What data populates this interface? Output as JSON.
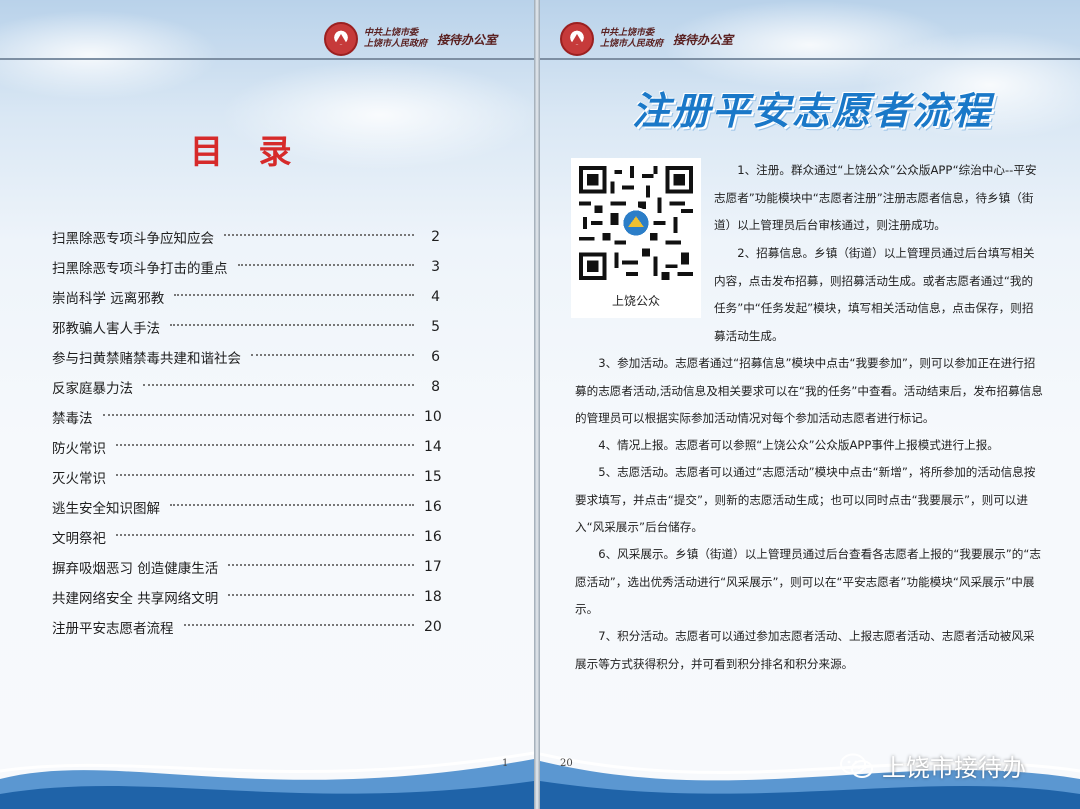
{
  "header": {
    "org_line1": "中共上饶市委",
    "org_line2": "上饶市人民政府",
    "office": "接待办公室"
  },
  "left_page": {
    "title": "目 录",
    "toc": [
      {
        "label": "扫黑除恶专项斗争应知应会",
        "page": "2"
      },
      {
        "label": "扫黑除恶专项斗争打击的重点",
        "page": "3"
      },
      {
        "label": "崇尚科学  远离邪教",
        "page": "4"
      },
      {
        "label": "邪教骗人害人手法",
        "page": "5"
      },
      {
        "label": "参与扫黄禁赌禁毒共建和谐社会",
        "page": "6"
      },
      {
        "label": "反家庭暴力法",
        "page": "8"
      },
      {
        "label": "禁毒法",
        "page": "10"
      },
      {
        "label": "防火常识",
        "page": "14"
      },
      {
        "label": "灭火常识",
        "page": "15"
      },
      {
        "label": "逃生安全知识图解",
        "page": "16"
      },
      {
        "label": "文明祭祀",
        "page": "16"
      },
      {
        "label": "摒弃吸烟恶习 创造健康生活",
        "page": "17"
      },
      {
        "label": "共建网络安全  共享网络文明",
        "page": "18"
      },
      {
        "label": "注册平安志愿者流程",
        "page": "20"
      }
    ],
    "page_number": "1"
  },
  "right_page": {
    "title": "注册平安志愿者流程",
    "qr_caption": "上饶公众",
    "para1": "1、注册。群众通过“上饶公众”公众版APP“综治中心--平安志愿者”功能模块中“志愿者注册”注册志愿者信息，待乡镇（街道）以上管理员后台审核通过，则注册成功。",
    "para2": "2、招募信息。乡镇（街道）以上管理员通过后台填写相关内容，点击发布招募，则招募活动生成。或者志愿者通过“我的任务”中“任务发起”模块，填写相关活动信息，点击保存，则招募活动生成。",
    "para3": "3、参加活动。志愿者通过“招募信息”模块中点击“我要参加”，则可以参加正在进行招募的志愿者活动,活动信息及相关要求可以在“我的任务”中查看。活动结束后，发布招募信息的管理员可以根据实际参加活动情况对每个参加活动志愿者进行标记。",
    "para4": "4、情况上报。志愿者可以参照“上饶公众”公众版APP事件上报模式进行上报。",
    "para5": "5、志愿活动。志愿者可以通过“志愿活动”模块中点击“新增”，将所参加的活动信息按要求填写，并点击“提交”，则新的志愿活动生成；也可以同时点击“我要展示”，则可以进入“风采展示”后台储存。",
    "para6": "6、风采展示。乡镇（街道）以上管理员通过后台查看各志愿者上报的“我要展示”的“志愿活动”，选出优秀活动进行“风采展示”，则可以在“平安志愿者”功能模块“风采展示”中展示。",
    "para7": "7、积分活动。志愿者可以通过参加志愿者活动、上报志愿者活动、志愿者活动被风采展示等方式获得积分，并可看到积分排名和积分来源。",
    "page_number": "20"
  },
  "watermark": "上饶市接待办"
}
